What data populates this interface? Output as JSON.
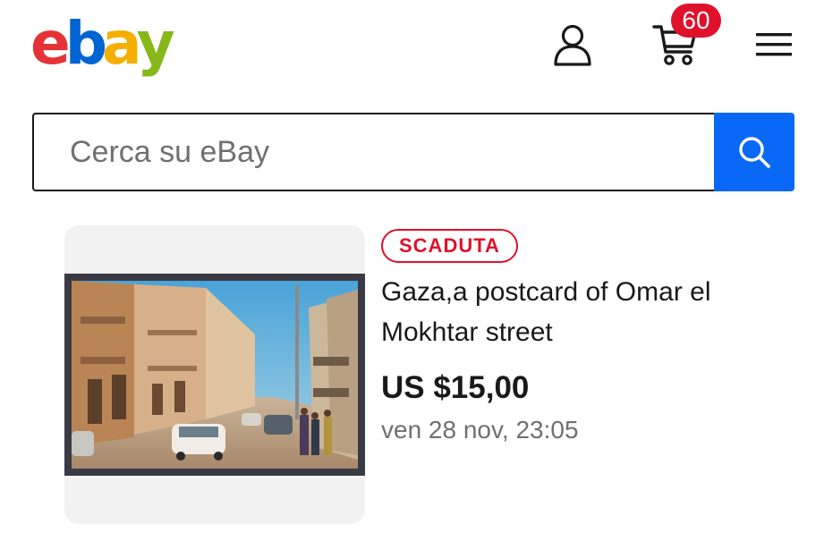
{
  "header": {
    "logo": {
      "letters": [
        "e",
        "b",
        "a",
        "y"
      ],
      "colors": [
        "#e53238",
        "#0064d2",
        "#f5af02",
        "#86b817"
      ]
    },
    "icons": [
      "user-icon",
      "cart-icon",
      "menu-icon"
    ],
    "cart_count": "60"
  },
  "search": {
    "placeholder": "Cerca su eBay",
    "button_icon": "search-icon"
  },
  "listing": {
    "status_badge": "SCADUTA",
    "title": "Gaza,a postcard of Omar el Mokhtar street",
    "price": "US $15,00",
    "end_date": "ven 28 nov, 23:05"
  },
  "colors": {
    "accent": "#0968f6",
    "badge_red": "#e0112b",
    "text": "#191919",
    "muted": "#707070",
    "card_bg": "#f2f2f2"
  }
}
